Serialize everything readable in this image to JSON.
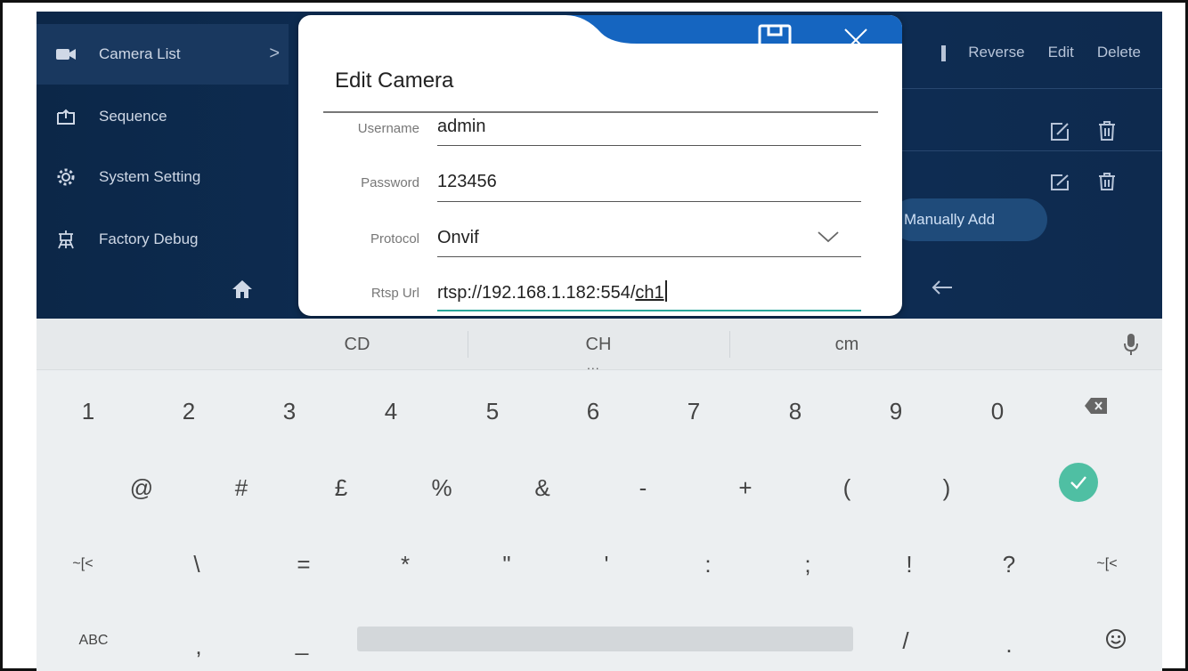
{
  "sidebar": {
    "items": [
      {
        "label": "Camera List",
        "icon": "camera-icon",
        "active": true
      },
      {
        "label": "Sequence",
        "icon": "sequence-icon"
      },
      {
        "label": "System Setting",
        "icon": "gear-icon"
      },
      {
        "label": "Factory Debug",
        "icon": "factory-debug-icon"
      }
    ],
    "home_icon": "home-icon"
  },
  "toolbar": {
    "reverse_label": "Reverse",
    "edit_label": "Edit",
    "delete_label": "Delete",
    "manual_add_label": "Manually Add"
  },
  "dialog": {
    "title": "Edit Camera",
    "fields": {
      "username": {
        "label": "Username",
        "value": "admin"
      },
      "password": {
        "label": "Password",
        "value": "123456"
      },
      "protocol": {
        "label": "Protocol",
        "value": "Onvif"
      },
      "rtsp": {
        "label": "Rtsp Url",
        "value_prefix": "rtsp://192.168.1.182:554/",
        "value_suffix": "ch1"
      }
    }
  },
  "keyboard": {
    "suggestions": [
      "CD",
      "CH",
      "cm"
    ],
    "suggestion_more": "...",
    "row1": [
      "1",
      "2",
      "3",
      "4",
      "5",
      "6",
      "7",
      "8",
      "9",
      "0"
    ],
    "row2": [
      "@",
      "#",
      "£",
      "%",
      "&",
      "-",
      "+",
      "(",
      ")"
    ],
    "row3": [
      "~[<",
      "\\",
      "=",
      "*",
      "\"",
      "'",
      ":",
      ";",
      "!",
      "?",
      "~[<"
    ],
    "row4_left": "ABC",
    "row4_comma": ",",
    "row4_underscore": "_",
    "row4_slash": "/",
    "row4_period": "."
  },
  "colors": {
    "app_bg": "#0e2f57",
    "dialog_tab": "#1565c0",
    "accent": "#26a69a",
    "enter": "#4fbfa3"
  }
}
